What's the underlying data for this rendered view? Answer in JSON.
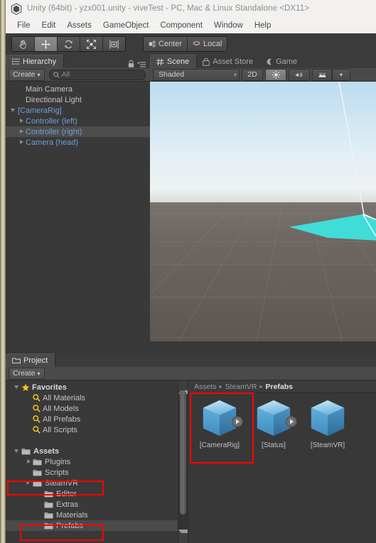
{
  "window": {
    "title": "Unity (64bit) - yzx001.unity - viveTest - PC, Mac & Linux Standalone <DX11>",
    "app_icon": "unity-logo-icon"
  },
  "menubar": {
    "items": [
      "File",
      "Edit",
      "Assets",
      "GameObject",
      "Component",
      "Window",
      "Help"
    ]
  },
  "toolbar": {
    "tools": [
      {
        "name": "hand-tool",
        "icon": "hand-icon",
        "active": false
      },
      {
        "name": "move-tool",
        "icon": "move-icon",
        "active": true
      },
      {
        "name": "rotate-tool",
        "icon": "rotate-icon",
        "active": false
      },
      {
        "name": "scale-tool",
        "icon": "scale-icon",
        "active": false
      },
      {
        "name": "rect-tool",
        "icon": "rect-transform-icon",
        "active": false
      }
    ],
    "pivot_label": "Center",
    "pivot_icon": "pivot-center-icon",
    "rotation_label": "Local",
    "rotation_icon": "handle-local-icon"
  },
  "hierarchy": {
    "tab_label": "Hierarchy",
    "tab_icon": "hierarchy-icon",
    "lock_icon": "lock-icon",
    "menu_icon": "panel-menu-icon",
    "create_label": "Create",
    "search_placeholder": "All",
    "search_value": "",
    "search_icon": "search-icon",
    "items": [
      {
        "label": "Main Camera",
        "indent": 1,
        "expander": "none",
        "prefab": false,
        "selected": false
      },
      {
        "label": "Directional Light",
        "indent": 1,
        "expander": "none",
        "prefab": false,
        "selected": false
      },
      {
        "label": "[CameraRig]",
        "indent": 0,
        "expander": "down",
        "prefab": true,
        "selected": false
      },
      {
        "label": "Controller (left)",
        "indent": 1,
        "expander": "right",
        "prefab": true,
        "selected": false
      },
      {
        "label": "Controller (right)",
        "indent": 1,
        "expander": "right",
        "prefab": true,
        "selected": true
      },
      {
        "label": "Camera (head)",
        "indent": 1,
        "expander": "right",
        "prefab": true,
        "selected": false
      }
    ]
  },
  "scene": {
    "tabs": [
      {
        "label": "Scene",
        "icon": "scene-icon",
        "active": true
      },
      {
        "label": "Asset Store",
        "icon": "asset-store-icon",
        "active": false
      },
      {
        "label": "Game",
        "icon": "game-icon",
        "active": false
      }
    ],
    "draw_mode": "Shaded",
    "two_d_label": "2D",
    "lighting_icon": "sun-icon",
    "lighting_on": true,
    "audio_icon": "audio-icon",
    "effects_icon": "effects-icon",
    "effects_caret": "▾"
  },
  "project": {
    "tab_label": "Project",
    "tab_icon": "project-folder-icon",
    "create_label": "Create",
    "tree": [
      {
        "label": "Favorites",
        "indent": 0,
        "expander": "down",
        "icon": "star-icon",
        "bold": true,
        "selected": false
      },
      {
        "label": "All Materials",
        "indent": 1,
        "expander": "none",
        "icon": "search-icon",
        "bold": false,
        "selected": false
      },
      {
        "label": "All Models",
        "indent": 1,
        "expander": "none",
        "icon": "search-icon",
        "bold": false,
        "selected": false
      },
      {
        "label": "All Prefabs",
        "indent": 1,
        "expander": "none",
        "icon": "search-icon",
        "bold": false,
        "selected": false
      },
      {
        "label": "All Scripts",
        "indent": 1,
        "expander": "none",
        "icon": "search-icon",
        "bold": false,
        "selected": false
      },
      {
        "label": "",
        "indent": 0,
        "expander": "none",
        "icon": "none",
        "bold": false,
        "selected": false
      },
      {
        "label": "Assets",
        "indent": 0,
        "expander": "down",
        "icon": "folder-icon",
        "bold": true,
        "selected": false
      },
      {
        "label": "Plugins",
        "indent": 1,
        "expander": "right",
        "icon": "folder-icon",
        "bold": false,
        "selected": false
      },
      {
        "label": "Scripts",
        "indent": 1,
        "expander": "none",
        "icon": "folder-icon",
        "bold": false,
        "selected": false
      },
      {
        "label": "SteamVR",
        "indent": 1,
        "expander": "down",
        "icon": "folder-icon",
        "bold": false,
        "selected": false
      },
      {
        "label": "Editor",
        "indent": 2,
        "expander": "none",
        "icon": "folder-icon",
        "bold": false,
        "selected": false
      },
      {
        "label": "Extras",
        "indent": 2,
        "expander": "none",
        "icon": "folder-icon",
        "bold": false,
        "selected": false
      },
      {
        "label": "Materials",
        "indent": 2,
        "expander": "none",
        "icon": "folder-icon",
        "bold": false,
        "selected": false
      },
      {
        "label": "Prefabs",
        "indent": 2,
        "expander": "none",
        "icon": "folder-icon",
        "bold": false,
        "selected": true
      }
    ],
    "breadcrumb": [
      "Assets",
      "SteamVR",
      "Prefabs"
    ],
    "breadcrumb_separator": "▸",
    "assets": [
      {
        "label": "[CameraRig]",
        "icon": "prefab-cube-icon",
        "badge": "prefab-arrow-badge",
        "selected": true
      },
      {
        "label": "[Status]",
        "icon": "prefab-cube-icon",
        "badge": "prefab-arrow-badge",
        "selected": false
      },
      {
        "label": "[SteamVR]",
        "icon": "prefab-cube-icon",
        "badge": "none",
        "selected": false
      }
    ]
  },
  "annotations": {
    "highlight_color": "#fe0000",
    "boxes": [
      "steamvr-folder-row",
      "prefabs-folder-row",
      "camerarig-asset-tile"
    ]
  },
  "colors": {
    "panel_bg": "#383838",
    "panel_alt": "#393939",
    "selection": "#4d4d4d",
    "prefab_blue": "#6f9fd8",
    "titlebar": "#f2f1f0",
    "accent_red": "#fe0000",
    "cube_blue": "#4f9fd1",
    "scene_select_cyan": "#35e5e0"
  }
}
